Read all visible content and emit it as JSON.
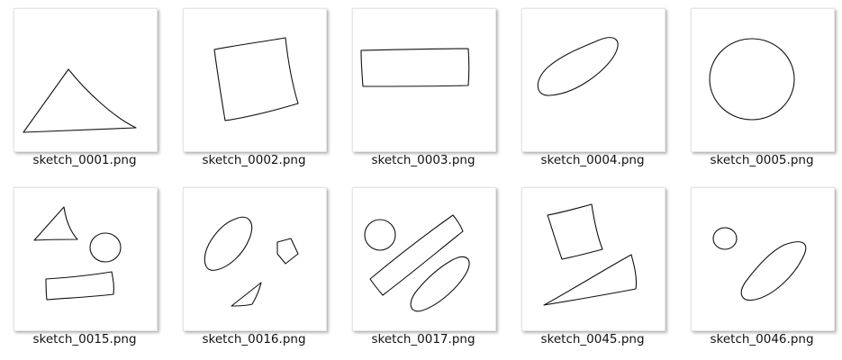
{
  "files": [
    {
      "name": "sketch_0001.png",
      "icon": "image-thumbnail-icon"
    },
    {
      "name": "sketch_0002.png",
      "icon": "image-thumbnail-icon"
    },
    {
      "name": "sketch_0003.png",
      "icon": "image-thumbnail-icon"
    },
    {
      "name": "sketch_0004.png",
      "icon": "image-thumbnail-icon"
    },
    {
      "name": "sketch_0005.png",
      "icon": "image-thumbnail-icon"
    },
    {
      "name": "sketch_0015.png",
      "icon": "image-thumbnail-icon"
    },
    {
      "name": "sketch_0016.png",
      "icon": "image-thumbnail-icon"
    },
    {
      "name": "sketch_0017.png",
      "icon": "image-thumbnail-icon"
    },
    {
      "name": "sketch_0045.png",
      "icon": "image-thumbnail-icon"
    },
    {
      "name": "sketch_0046.png",
      "icon": "image-thumbnail-icon"
    }
  ],
  "colors": {
    "background": "#ffffff",
    "stroke": "#111111",
    "label_text": "#111111"
  }
}
